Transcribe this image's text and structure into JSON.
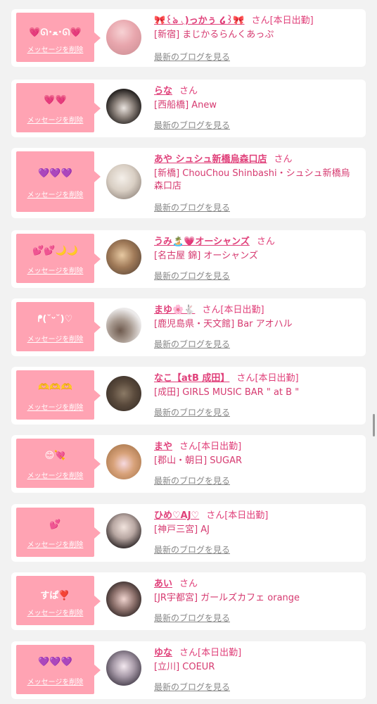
{
  "cards": [
    {
      "message": "💗ᘏ･ﻌ･ᘏ💗",
      "delete_label": "メッセージを削除",
      "name": "🎀꒰ঌ ◟)っかぅ ໒꒱🎀",
      "san": "さん",
      "status": "[本日出勤]",
      "shop": "[新宿] まじかるらんくあっぷ",
      "blog_label": "最新のブログを見る"
    },
    {
      "message": "💗💗",
      "delete_label": "メッセージを削除",
      "name": "らな",
      "san": "さん",
      "status": "",
      "shop": "[西船橋] Anew",
      "blog_label": "最新のブログを見る"
    },
    {
      "message": "💜💜💜",
      "delete_label": "メッセージを削除",
      "name": "あや シュシュ新橋烏森口店",
      "san": "さん",
      "status": "",
      "shop": "[新橋] ChouChou Shinbashi・シュシュ新橋烏森口店",
      "blog_label": "最新のブログを見る"
    },
    {
      "message": "💕💕🌙🌙",
      "delete_label": "メッセージを削除",
      "name": "うみ🏝️💗オーシャンズ",
      "san": "さん",
      "status": "",
      "shop": "[名古屋 錦] オーシャンズ",
      "blog_label": "最新のブログを見る"
    },
    {
      "message": "ᖰ(˘ᵕ˘)♡",
      "delete_label": "メッセージを削除",
      "name": "まゆ🌸🐇",
      "san": "さん",
      "status": "[本日出勤]",
      "shop": "[鹿児島県・天文館] Bar アオハル",
      "blog_label": "最新のブログを見る"
    },
    {
      "message": "🫶🫶🫶",
      "delete_label": "メッセージを削除",
      "name": "なこ【atB 成田】",
      "san": "さん",
      "status": "[本日出勤]",
      "shop": "[成田] GIRLS MUSIC BAR \" at B \"",
      "blog_label": "最新のブログを見る"
    },
    {
      "message": "😊💘",
      "delete_label": "メッセージを削除",
      "name": "まや",
      "san": "さん",
      "status": "[本日出勤]",
      "shop": "[郡山・朝日] SUGAR",
      "blog_label": "最新のブログを見る"
    },
    {
      "message": "💕",
      "delete_label": "メッセージを削除",
      "name": "ひめ♡AJ♡",
      "san": "さん",
      "status": "[本日出勤]",
      "shop": "[神戸三宮] AJ",
      "blog_label": "最新のブログを見る"
    },
    {
      "message": "すぱ❣️",
      "delete_label": "メッセージを削除",
      "name": "あい",
      "san": "さん",
      "status": "",
      "shop": "[JR宇都宮] ガールズカフェ orange",
      "blog_label": "最新のブログを見る"
    },
    {
      "message": "💜💜💜",
      "delete_label": "メッセージを削除",
      "name": "ゆな",
      "san": "さん",
      "status": "[本日出勤]",
      "shop": "[立川] COEUR",
      "blog_label": "最新のブログを見る"
    }
  ],
  "colors": {
    "bubble": "#ffa3b3",
    "name": "#e0407a",
    "page_bg": "#f2f2f2"
  }
}
